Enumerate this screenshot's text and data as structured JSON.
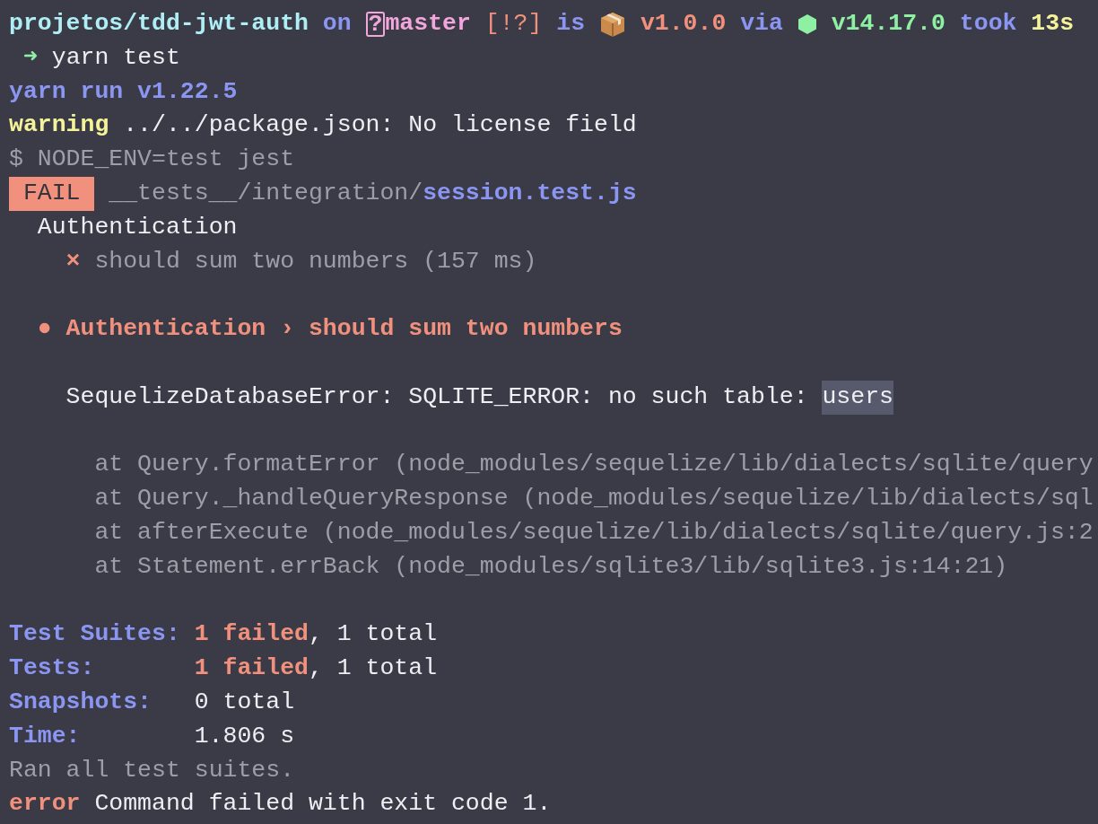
{
  "prompt": {
    "directory": "projetos/tdd-jwt-auth",
    "on": "on",
    "branch_symbol": "?",
    "branch": "master",
    "git_status": "[!?]",
    "is": "is",
    "package_version": "v1.0.0",
    "via": "via",
    "node_version": "v14.17.0",
    "took": "took",
    "duration": "13s"
  },
  "command": {
    "symbol": "➜",
    "text": "yarn test"
  },
  "lines": [
    {
      "kind": "output",
      "parts": [
        {
          "text": "yarn run v1.22.5",
          "kind": "accent"
        }
      ]
    },
    {
      "kind": "output",
      "parts": [
        {
          "text": "warning",
          "kind": "warn"
        },
        {
          "text": "../../package.json: No license field",
          "kind": "plain"
        }
      ]
    },
    {
      "kind": "output",
      "parts": [
        {
          "text": "$ NODE_ENV=test jest",
          "kind": "dim"
        }
      ]
    },
    {
      "kind": "output",
      "parts": [
        {
          "text": "FAIL",
          "kind": "badge"
        },
        {
          "text": "__tests__/integration/",
          "kind": "dim"
        },
        {
          "text": "session.test.js",
          "kind": "accent",
          "attached": true
        }
      ]
    },
    {
      "kind": "test-title",
      "parts": [
        {
          "text": "Authentication",
          "kind": "plain"
        }
      ]
    },
    {
      "kind": "test-case",
      "parts": [
        {
          "text": "×",
          "kind": "error"
        },
        {
          "text": "should sum two numbers (157 ms)",
          "kind": "dim"
        }
      ]
    },
    {
      "kind": "blank"
    },
    {
      "kind": "error-heading",
      "parts": [
        {
          "text": "● Authentication › should sum two numbers",
          "kind": "error"
        }
      ]
    },
    {
      "kind": "blank"
    },
    {
      "kind": "error-message",
      "parts": [
        {
          "text": "SequelizeDatabaseError: SQLITE_ERROR: no such table:",
          "kind": "plain"
        },
        {
          "text": "users",
          "kind": "highlight"
        }
      ]
    },
    {
      "kind": "blank"
    },
    {
      "kind": "stack",
      "parts": [
        {
          "text": "at Query.formatError (node_modules/sequelize/lib/dialects/sqlite/query",
          "kind": "dim"
        }
      ]
    },
    {
      "kind": "stack",
      "parts": [
        {
          "text": "at Query._handleQueryResponse (node_modules/sequelize/lib/dialects/sql",
          "kind": "dim"
        }
      ]
    },
    {
      "kind": "stack",
      "parts": [
        {
          "text": "at afterExecute (node_modules/sequelize/lib/dialects/sqlite/query.js:2",
          "kind": "dim"
        }
      ]
    },
    {
      "kind": "stack",
      "parts": [
        {
          "text": "at Statement.errBack (node_modules/sqlite3/lib/sqlite3.js:14:21)",
          "kind": "dim"
        }
      ]
    },
    {
      "kind": "blank"
    },
    {
      "kind": "summary",
      "label": "Test Suites:",
      "parts": [
        {
          "text": "1 failed",
          "kind": "error"
        },
        {
          "text": ", 1 total",
          "kind": "plain",
          "attached": true
        }
      ]
    },
    {
      "kind": "summary",
      "label": "Tests:",
      "parts": [
        {
          "text": "1 failed",
          "kind": "error"
        },
        {
          "text": ", 1 total",
          "kind": "plain",
          "attached": true
        }
      ]
    },
    {
      "kind": "summary",
      "label": "Snapshots:",
      "parts": [
        {
          "text": "0 total",
          "kind": "plain"
        }
      ]
    },
    {
      "kind": "summary",
      "label": "Time:",
      "parts": [
        {
          "text": "1.806 s",
          "kind": "plain"
        }
      ]
    },
    {
      "kind": "output",
      "parts": [
        {
          "text": "Ran all test suites.",
          "kind": "dim"
        }
      ]
    },
    {
      "kind": "output",
      "parts": [
        {
          "text": "error",
          "kind": "error"
        },
        {
          "text": "Command failed with exit code 1.",
          "kind": "plain"
        }
      ]
    }
  ]
}
